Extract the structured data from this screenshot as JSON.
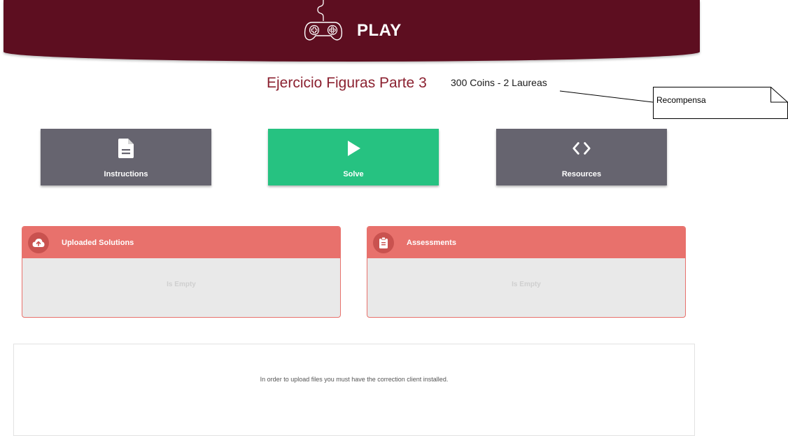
{
  "header": {
    "title": "PLAY",
    "icon": "gamepad-icon",
    "color": "#5d0e20"
  },
  "exercise": {
    "title": "Ejercicio Figuras Parte 3",
    "reward": "300 Coins - 2 Laureas"
  },
  "callout": {
    "label": "Recompensa"
  },
  "tiles": [
    {
      "label": "Instructions",
      "icon": "document-icon",
      "color": "#66646f"
    },
    {
      "label": "Solve",
      "icon": "play-icon",
      "color": "#26c281"
    },
    {
      "label": "Resources",
      "icon": "code-icon",
      "color": "#66646f"
    }
  ],
  "panels": [
    {
      "title": "Uploaded Solutions",
      "icon": "cloud-upload-icon",
      "empty_text": "Is Empty"
    },
    {
      "title": "Assessments",
      "icon": "clipboard-icon",
      "empty_text": "Is Empty"
    }
  ],
  "info": {
    "text": "In order to upload files you must have the correction client installed."
  },
  "colors": {
    "accent": "#e8716c",
    "title": "#8b2130",
    "success": "#26c281",
    "neutral": "#66646f"
  }
}
